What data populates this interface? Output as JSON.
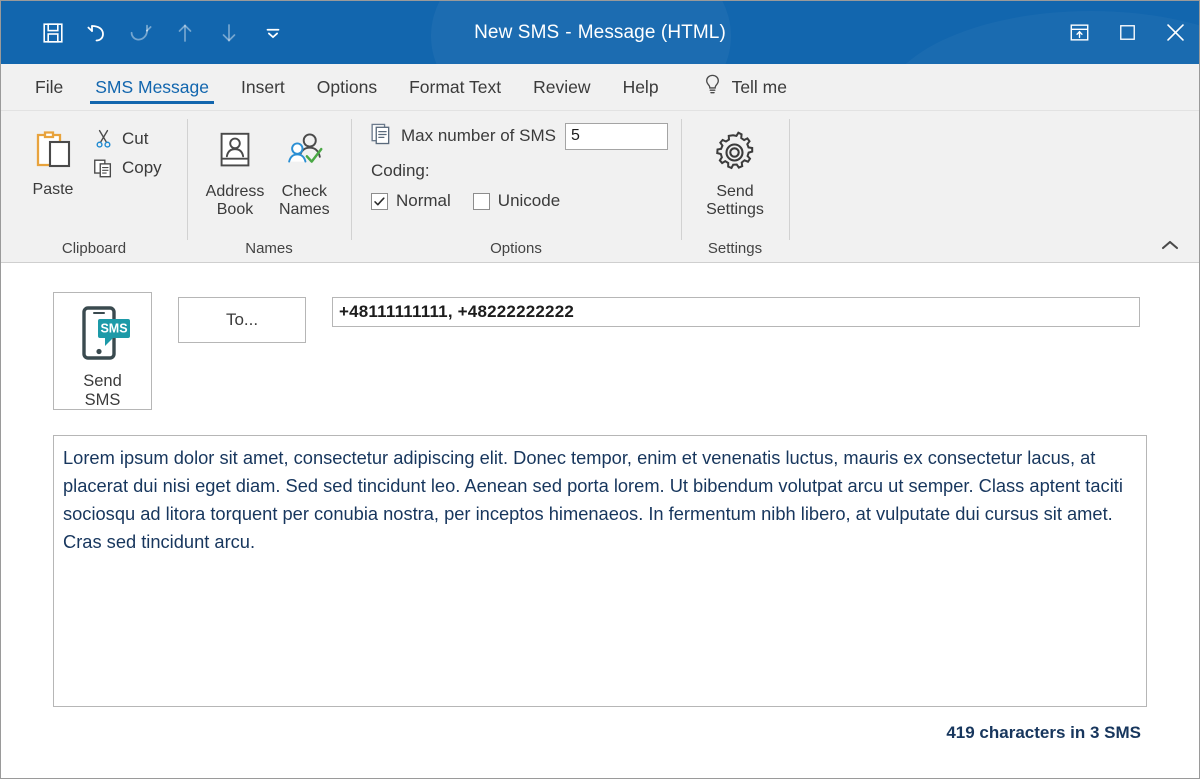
{
  "titlebar": {
    "quick_access": [
      {
        "name": "save-icon",
        "label": "Save",
        "enabled": true
      },
      {
        "name": "undo-icon",
        "label": "Undo",
        "enabled": true
      },
      {
        "name": "redo-icon",
        "label": "Redo",
        "enabled": false
      },
      {
        "name": "previous-item-icon",
        "label": "Previous Item",
        "enabled": false
      },
      {
        "name": "next-item-icon",
        "label": "Next Item",
        "enabled": false
      },
      {
        "name": "customize-quick-access-toolbar-icon",
        "label": "Customize Quick Access Toolbar",
        "enabled": true
      }
    ],
    "title": "New SMS",
    "separator": "-",
    "subtitle": "Message (HTML)",
    "window_controls": [
      {
        "name": "ribbon-display-options-icon",
        "label": "Ribbon Display Options"
      },
      {
        "name": "maximize-icon",
        "label": "Maximize"
      },
      {
        "name": "close-icon",
        "label": "Close"
      }
    ],
    "background_color": "#1266ae"
  },
  "tabs": [
    {
      "label": "File",
      "active": false
    },
    {
      "label": "SMS Message",
      "active": true
    },
    {
      "label": "Insert",
      "active": false
    },
    {
      "label": "Options",
      "active": false
    },
    {
      "label": "Format Text",
      "active": false
    },
    {
      "label": "Review",
      "active": false
    },
    {
      "label": "Help",
      "active": false
    }
  ],
  "tell_me": {
    "label": "Tell me",
    "icon": "lightbulb-icon"
  },
  "ribbon": {
    "accent_color": "#1266ae",
    "groups": [
      {
        "name": "clipboard",
        "label": "Clipboard",
        "paste": {
          "label": "Paste",
          "icon": "paste-icon"
        },
        "cut": {
          "label": "Cut",
          "icon": "scissors-icon"
        },
        "copy": {
          "label": "Copy",
          "icon": "copy-icon"
        }
      },
      {
        "name": "names",
        "label": "Names",
        "address_book": {
          "label": "Address\nBook",
          "line1": "Address",
          "line2": "Book",
          "icon": "address-book-icon"
        },
        "check_names": {
          "label": "Check\nNames",
          "line1": "Check",
          "line2": "Names",
          "icon": "check-names-icon"
        }
      },
      {
        "name": "options",
        "label": "Options",
        "max_sms_label": "Max number of SMS",
        "max_sms_icon": "documents-icon",
        "max_sms_value": "5",
        "coding_label": "Coding:",
        "coding_options": [
          {
            "label": "Normal",
            "checked": true
          },
          {
            "label": "Unicode",
            "checked": false
          }
        ]
      },
      {
        "name": "settings",
        "label": "Settings",
        "send_settings": {
          "line1": "Send",
          "line2": "Settings",
          "icon": "gear-icon"
        }
      }
    ],
    "collapse": {
      "icon": "chevron-up-icon",
      "label": "Collapse the Ribbon"
    }
  },
  "compose": {
    "send_sms_button": {
      "line1": "Send",
      "line2": "SMS",
      "icon": "sms-phone-icon",
      "badge": "SMS"
    },
    "to_button": "To...",
    "to_value": "+48111111111, +48222222222",
    "message_body": "Lorem ipsum dolor sit amet, consectetur adipiscing elit. Donec tempor, enim et venenatis luctus, mauris ex consectetur lacus, at placerat dui nisi eget diam. Sed sed tincidunt leo. Aenean sed porta lorem. Ut bibendum volutpat arcu ut semper. Class aptent taciti sociosqu ad litora torquent per conubia nostra, per inceptos himenaeos. In fermentum nibh libero, at vulputate dui cursus sit amet. Cras sed tincidunt arcu.",
    "status": "419 characters in 3 SMS",
    "status_characters": 419,
    "status_sms_count": 3,
    "text_color": "#17365d"
  }
}
